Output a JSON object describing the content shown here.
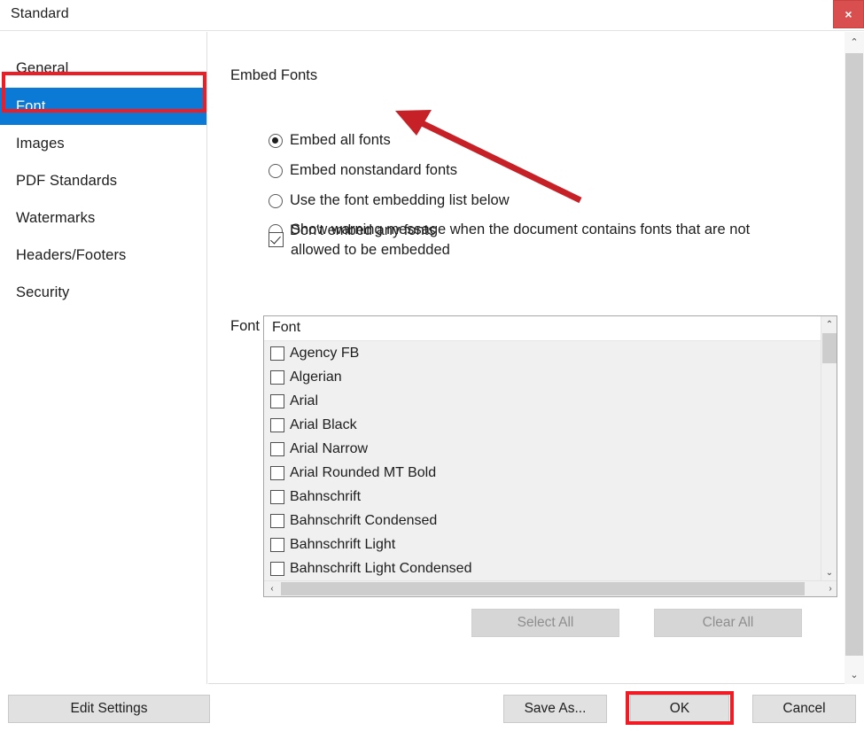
{
  "window": {
    "title": "Standard",
    "close_label": "×"
  },
  "sidebar": {
    "items": [
      {
        "label": "General",
        "selected": false
      },
      {
        "label": "Font",
        "selected": true
      },
      {
        "label": "Images",
        "selected": false
      },
      {
        "label": "PDF Standards",
        "selected": false
      },
      {
        "label": "Watermarks",
        "selected": false
      },
      {
        "label": "Headers/Footers",
        "selected": false
      },
      {
        "label": "Security",
        "selected": false
      }
    ],
    "highlight_color": "#ee1c25",
    "selected_color": "#0a7ad6"
  },
  "main": {
    "embed_fonts_title": "Embed Fonts",
    "radio_options": [
      {
        "label": "Embed all fonts",
        "checked": true
      },
      {
        "label": "Embed nonstandard fonts",
        "checked": false
      },
      {
        "label": "Use the font embedding list below",
        "checked": false
      },
      {
        "label": "Don't embed any fonts",
        "checked": false
      }
    ],
    "warning_checkbox": {
      "label": "Show warning message when the document contains fonts that are not allowed to be embedded",
      "checked": true
    },
    "font_list_title": "Font Embedding List:",
    "list_header": "Font",
    "fonts": [
      {
        "name": "Agency FB",
        "checked": false
      },
      {
        "name": "Algerian",
        "checked": false
      },
      {
        "name": "Arial",
        "checked": false
      },
      {
        "name": "Arial Black",
        "checked": false
      },
      {
        "name": "Arial Narrow",
        "checked": false
      },
      {
        "name": "Arial Rounded MT Bold",
        "checked": false
      },
      {
        "name": "Bahnschrift",
        "checked": false
      },
      {
        "name": "Bahnschrift Condensed",
        "checked": false
      },
      {
        "name": "Bahnschrift Light",
        "checked": false
      },
      {
        "name": "Bahnschrift Light Condensed",
        "checked": false
      }
    ],
    "select_all_label": "Select All",
    "clear_all_label": "Clear All"
  },
  "footer": {
    "edit_settings_label": "Edit Settings",
    "save_as_label": "Save As...",
    "ok_label": "OK",
    "cancel_label": "Cancel"
  },
  "scroll_icons": {
    "up": "⌃",
    "down": "⌄",
    "left": "‹",
    "right": "›"
  },
  "annotation": {
    "arrow_color": "#c62127"
  }
}
